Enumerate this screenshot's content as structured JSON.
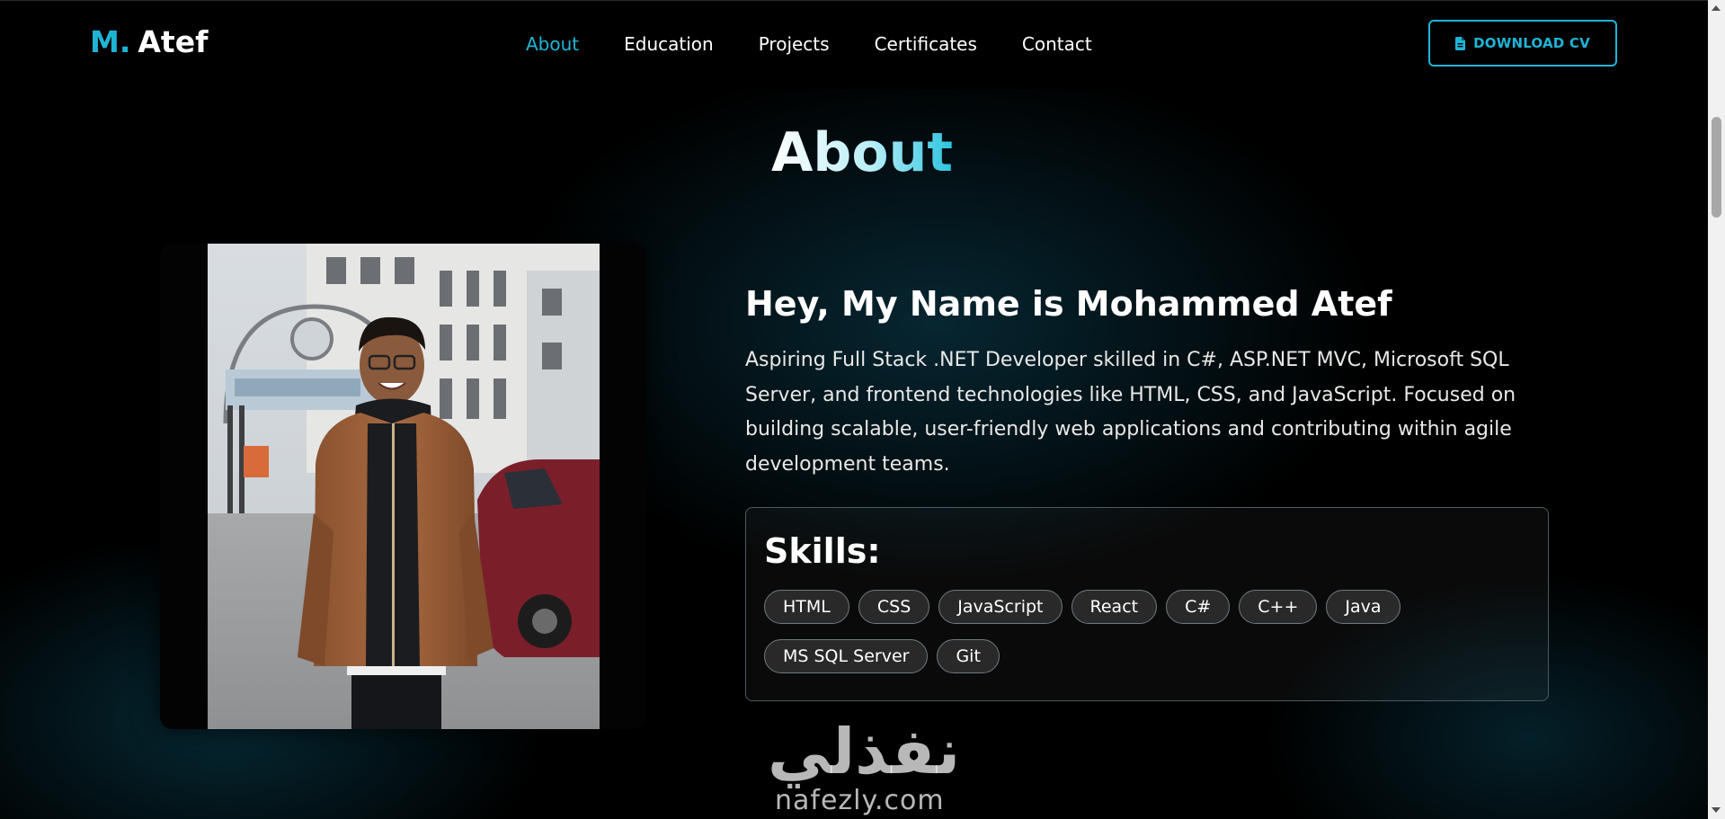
{
  "brand": {
    "initial": "M.",
    "name": "Atef",
    "accent_color": "#1fb4d6"
  },
  "nav": {
    "links": [
      {
        "label": "About",
        "active": true
      },
      {
        "label": "Education",
        "active": false
      },
      {
        "label": "Projects",
        "active": false
      },
      {
        "label": "Certificates",
        "active": false
      },
      {
        "label": "Contact",
        "active": false
      }
    ],
    "download_button": {
      "label": "DOWNLOAD CV",
      "icon": "file-icon"
    }
  },
  "about": {
    "section_title": "About",
    "photo_icon": "profile-photo",
    "heading": "Hey, My Name is Mohammed Atef",
    "bio": "Aspiring Full Stack .NET Developer skilled in C#, ASP.NET MVC, Microsoft SQL Server, and frontend technologies like HTML, CSS, and JavaScript. Focused on building scalable, user-friendly web applications and contributing within agile development teams.",
    "skills_title": "Skills:",
    "skills": [
      "HTML",
      "CSS",
      "JavaScript",
      "React",
      "C#",
      "C++",
      "Java",
      "MS SQL Server",
      "Git"
    ]
  },
  "watermark": {
    "arabic": "نفذلي",
    "latin": "nafezly.com"
  }
}
